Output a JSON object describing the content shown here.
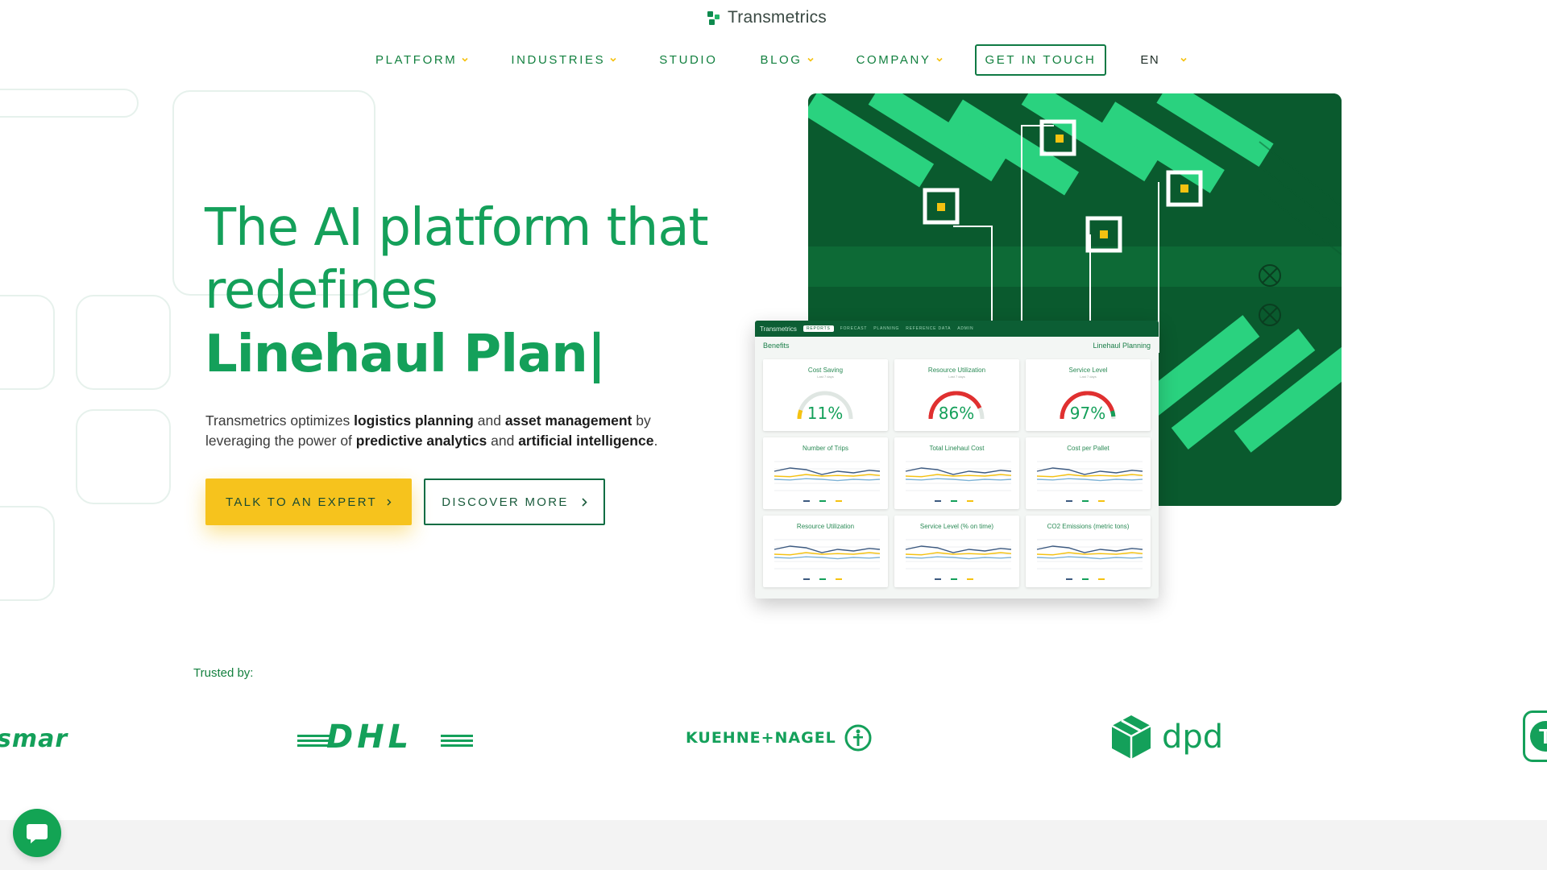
{
  "brand": {
    "name": "Transmetrics",
    "icon": "transmetrics-logo-icon"
  },
  "nav": {
    "items": [
      {
        "label": "PLATFORM",
        "has_dropdown": true
      },
      {
        "label": "INDUSTRIES",
        "has_dropdown": true
      },
      {
        "label": "STUDIO",
        "has_dropdown": false
      },
      {
        "label": "BLOG",
        "has_dropdown": true
      },
      {
        "label": "COMPANY",
        "has_dropdown": true
      }
    ],
    "cta": "GET IN TOUCH",
    "language": "EN"
  },
  "hero": {
    "headline_line1": "The AI platform that",
    "headline_line2": "redefines",
    "headline_highlight": "Linehaul Plan|",
    "lede": {
      "p1": "Transmetrics optimizes ",
      "b1": "logistics planning",
      "p2": " and ",
      "b2": "asset management",
      "p3": " by leveraging the power of ",
      "b3": "predictive analytics",
      "p4": " and ",
      "b4": "artificial intelligence",
      "p5": "."
    },
    "primary_button": "TALK TO AN EXPERT",
    "secondary_button": "DISCOVER MORE"
  },
  "dashboard": {
    "app_name": "Transmetrics",
    "tabs": [
      "REPORTS",
      "FORECAST",
      "PLANNING",
      "REFERENCE DATA",
      "ADMIN"
    ],
    "active_tab": "REPORTS",
    "section_title": "Benefits",
    "view_name": "Linehaul Planning",
    "gauges": [
      {
        "title": "Cost Saving",
        "subtitle": "Last 7 days",
        "value": "11%",
        "fill": 0.11
      },
      {
        "title": "Resource Utilization",
        "subtitle": "Last 7 days",
        "value": "86%",
        "fill": 0.86
      },
      {
        "title": "Service Level",
        "subtitle": "Last 7 days",
        "value": "97%",
        "fill": 0.97
      }
    ],
    "charts": [
      {
        "title": "Number of Trips"
      },
      {
        "title": "Total Linehaul Cost"
      },
      {
        "title": "Cost per Pallet"
      },
      {
        "title": "Resource Utilization"
      },
      {
        "title": "Service Level (% on time)"
      },
      {
        "title": "CO2 Emissions (metric tons)"
      }
    ],
    "colors": {
      "green": "#14a05a",
      "yellow": "#f5c211",
      "navy": "#3d5a80",
      "red": "#e03030"
    }
  },
  "trusted": {
    "label": "Trusted by:",
    "logos": [
      {
        "name": "smar",
        "text": "smar"
      },
      {
        "name": "dhl",
        "text": "DHL"
      },
      {
        "name": "kuehne-nagel",
        "text": "KUEHNE+NAGEL"
      },
      {
        "name": "dpd",
        "text": "dpd"
      },
      {
        "name": "partial-t",
        "text": "T"
      }
    ]
  },
  "chat": {
    "icon": "chat-bubble-icon"
  }
}
